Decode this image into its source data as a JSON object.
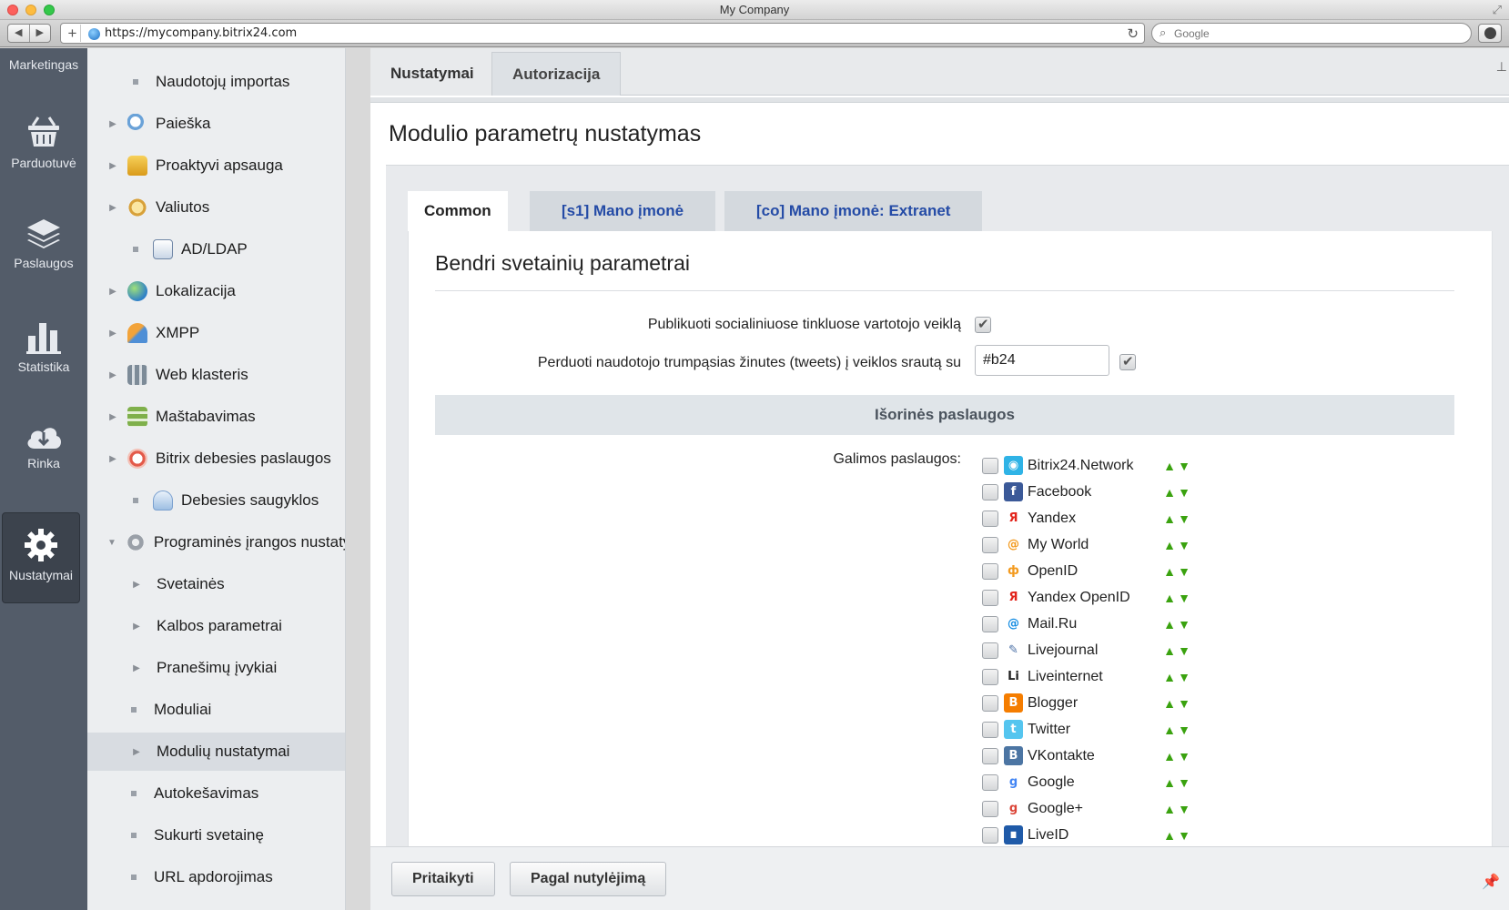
{
  "window": {
    "title": "My Company"
  },
  "browser": {
    "url": "https://mycompany.bitrix24.com",
    "search_placeholder": "Google"
  },
  "rail": {
    "items": [
      {
        "label": "Marketingas"
      },
      {
        "label": "Parduotuvė"
      },
      {
        "label": "Paslaugos"
      },
      {
        "label": "Statistika"
      },
      {
        "label": "Rinka"
      },
      {
        "label": "Nustatymai"
      }
    ]
  },
  "tree": {
    "items": [
      {
        "label": "Naudotojų importas"
      },
      {
        "label": "Paieška"
      },
      {
        "label": "Proaktyvi apsauga"
      },
      {
        "label": "Valiutos"
      },
      {
        "label": "AD/LDAP"
      },
      {
        "label": "Lokalizacija"
      },
      {
        "label": "XMPP"
      },
      {
        "label": "Web klasteris"
      },
      {
        "label": "Maštabavimas"
      },
      {
        "label": "Bitrix debesies paslaugos"
      },
      {
        "label": "Debesies saugyklos"
      },
      {
        "label": "Programinės įrangos nustaty"
      },
      {
        "label": "Svetainės"
      },
      {
        "label": "Kalbos parametrai"
      },
      {
        "label": "Pranešimų įvykiai"
      },
      {
        "label": "Moduliai"
      },
      {
        "label": "Modulių nustatymai"
      },
      {
        "label": "Autokešavimas"
      },
      {
        "label": "Sukurti svetainę"
      },
      {
        "label": "URL apdorojimas"
      }
    ]
  },
  "main": {
    "tabs": [
      {
        "label": "Nustatymai"
      },
      {
        "label": "Autorizacija"
      }
    ],
    "page_title": "Modulio parametrų nustatymas",
    "subtabs": [
      {
        "label": "Common"
      },
      {
        "label": "[s1] Mano įmonė"
      },
      {
        "label": "[co] Mano įmonė: Extranet"
      }
    ],
    "section_title": "Bendri svetainių parametrai",
    "options": {
      "publish_label": "Publikuoti socialiniuose tinkluose vartotojo veiklą",
      "tweets_label": "Perduoti naudotojo trumpąsias žinutes (tweets) į veiklos srautą su",
      "tweets_value": "#b24"
    },
    "external_header": "Išorinės paslaugos",
    "available_label": "Galimos paslaugos:",
    "services": [
      {
        "name": "Bitrix24.Network",
        "color": "#2fb3e6",
        "glyph": "◉"
      },
      {
        "name": "Facebook",
        "color": "#3b5998",
        "glyph": "f"
      },
      {
        "name": "Yandex",
        "color": "#ffffff",
        "glyph": "Я"
      },
      {
        "name": "My World",
        "color": "#ffffff",
        "glyph": "@"
      },
      {
        "name": "OpenID",
        "color": "#ffffff",
        "glyph": "ф"
      },
      {
        "name": "Yandex OpenID",
        "color": "#ffffff",
        "glyph": "Я"
      },
      {
        "name": "Mail.Ru",
        "color": "#ffffff",
        "glyph": "@"
      },
      {
        "name": "Livejournal",
        "color": "#ffffff",
        "glyph": "✎"
      },
      {
        "name": "Liveinternet",
        "color": "#ffffff",
        "glyph": "Li"
      },
      {
        "name": "Blogger",
        "color": "#f57d00",
        "glyph": "B"
      },
      {
        "name": "Twitter",
        "color": "#55c5ef",
        "glyph": "t"
      },
      {
        "name": "VKontakte",
        "color": "#4c75a3",
        "glyph": "B"
      },
      {
        "name": "Google",
        "color": "#ffffff",
        "glyph": "g"
      },
      {
        "name": "Google+",
        "color": "#ffffff",
        "glyph": "g"
      },
      {
        "name": "LiveID",
        "color": "#1f5aa8",
        "glyph": "∎"
      }
    ],
    "buttons": {
      "apply": "Pritaikyti",
      "default": "Pagal nutylėjimą"
    }
  }
}
